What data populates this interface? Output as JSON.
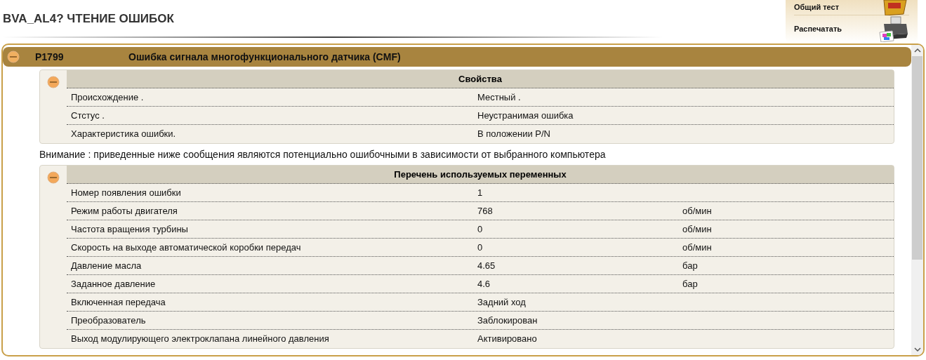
{
  "page_title": "BVA_AL4?  ЧТЕНИЕ ОШИБОК",
  "actions": [
    {
      "kind": "test",
      "label": "Общий тест"
    },
    {
      "kind": "print",
      "label": "Распечатать"
    }
  ],
  "fault": {
    "code": "P1799",
    "description": "Ошибка сигнала многофункционального датчика (CMF)",
    "expanded": true,
    "properties": {
      "title": "Свойства",
      "expanded": true,
      "rows": [
        {
          "label": "Происхождение .",
          "value": "Местный ."
        },
        {
          "label": "Стстус .",
          "value": "Неустранимая ошибка"
        },
        {
          "label": "Характеристика ошибки.",
          "value": "В положении P/N"
        }
      ]
    },
    "warning": "Внимание : приведенные ниже сообщения являются потенциально ошибочными в зависимости от выбранного компьютера",
    "variables": {
      "title": "Перечень используемых переменных",
      "expanded": true,
      "rows": [
        {
          "label": "Номер появления ошибки",
          "value": "1"
        },
        {
          "label": "Режим работы двигателя",
          "value": "768",
          "unit": "об/мин"
        },
        {
          "label": "Частота вращения турбины",
          "value": "0",
          "unit": "об/мин"
        },
        {
          "label": "Скорость на выходе автоматической коробки передач",
          "value": "0",
          "unit": "об/мин"
        },
        {
          "label": "Давление масла",
          "value": "4.65",
          "unit": "бар"
        },
        {
          "label": "Заданное давление",
          "value": "4.6",
          "unit": "бар"
        },
        {
          "label": "Включенная передача",
          "value": "Задний ход"
        },
        {
          "label": "Преобразователь",
          "value": "Заблокирован"
        },
        {
          "label": "Выход модулирующего электроклапана линейного давления",
          "value": "Активировано"
        }
      ]
    }
  }
}
